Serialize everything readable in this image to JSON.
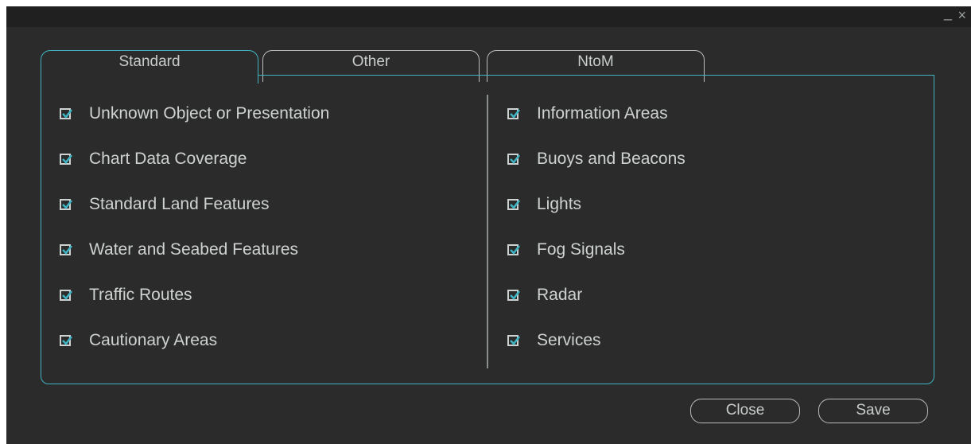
{
  "window": {
    "minimize_symbol": "_",
    "close_symbol": "×"
  },
  "tabs": [
    {
      "label": "Standard",
      "active": true
    },
    {
      "label": "Other",
      "active": false
    },
    {
      "label": "NtoM",
      "active": false
    }
  ],
  "left_items": [
    {
      "label": "Unknown Object or Presentation",
      "checked": true
    },
    {
      "label": "Chart Data Coverage",
      "checked": true
    },
    {
      "label": "Standard Land Features",
      "checked": true
    },
    {
      "label": "Water and Seabed Features",
      "checked": true
    },
    {
      "label": "Traffic Routes",
      "checked": true
    },
    {
      "label": "Cautionary Areas",
      "checked": true
    }
  ],
  "right_items": [
    {
      "label": "Information Areas",
      "checked": true
    },
    {
      "label": "Buoys and Beacons",
      "checked": true
    },
    {
      "label": "Lights",
      "checked": true
    },
    {
      "label": "Fog Signals",
      "checked": true
    },
    {
      "label": "Radar",
      "checked": true
    },
    {
      "label": "Services",
      "checked": true
    }
  ],
  "buttons": {
    "close_label": "Close",
    "save_label": "Save"
  },
  "colors": {
    "accent": "#3fb3c2",
    "background": "#2b2b2b",
    "text": "#cfd2d2"
  }
}
